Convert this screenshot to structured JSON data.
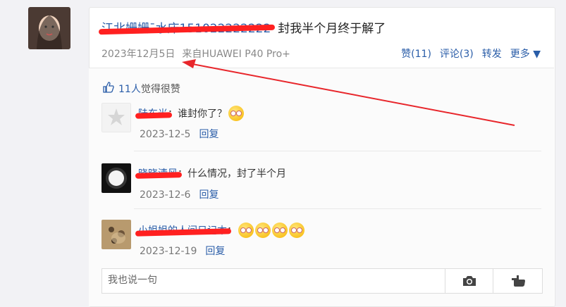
{
  "post": {
    "author": "江北姗姗¯水床151022222222",
    "text": "封我半个月终于解了",
    "date": "2023年12月5日",
    "source": "来自HUAWEI P40 Pro+",
    "like_label": "赞(11)",
    "comment_label": "评论(3)",
    "repost_label": "转发",
    "more_label": "更多"
  },
  "likes": {
    "count": "11人",
    "text": "觉得很赞"
  },
  "comments": [
    {
      "name": "陆东光",
      "text": "：谁封你了？",
      "date": "2023-12-5",
      "reply": "回复"
    },
    {
      "name": "晓晓清风",
      "text": "：什么情况，封了半个月",
      "date": "2023-12-6",
      "reply": "回复"
    },
    {
      "name": "小姐姐的人间日记本",
      "text": "：",
      "date": "2023-12-19",
      "reply": "回复"
    }
  ],
  "input": {
    "placeholder": "我也说一句"
  },
  "colors": {
    "link": "#2a5da8",
    "redact": "#ff2020"
  },
  "icons": {
    "camera": "camera-icon",
    "send": "send-icon",
    "thumb": "thumbs-up-icon"
  }
}
